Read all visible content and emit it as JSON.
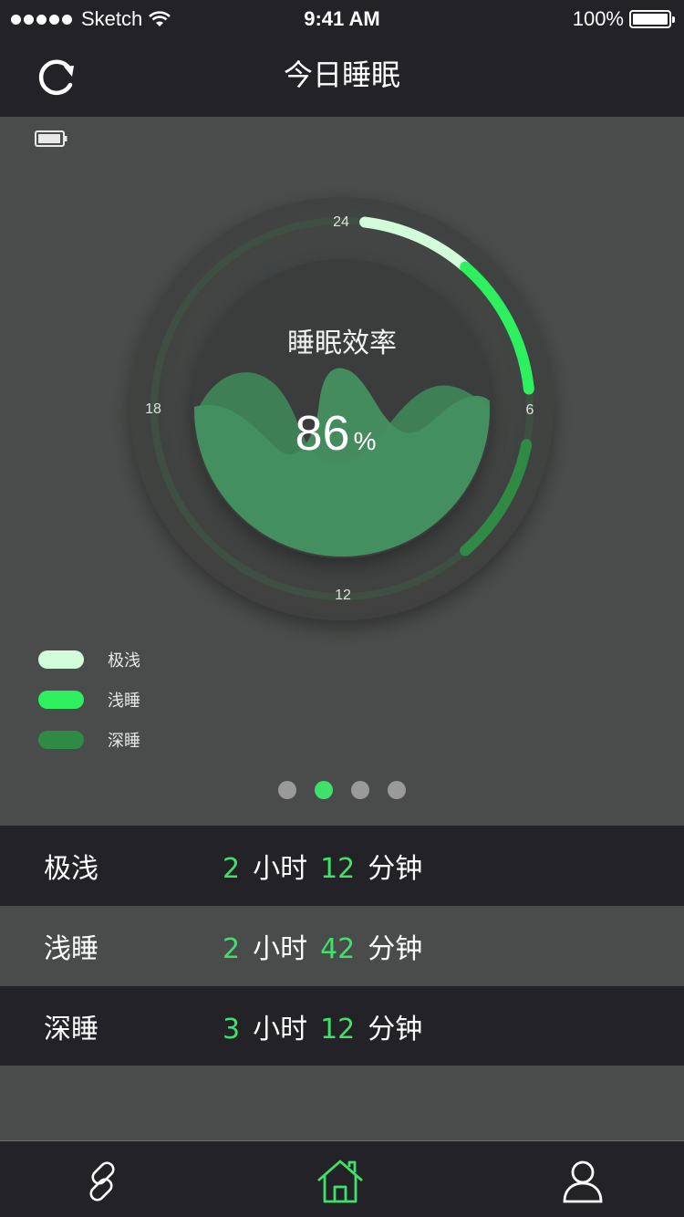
{
  "status_bar": {
    "carrier": "Sketch",
    "time": "9:41 AM",
    "battery": "100%"
  },
  "nav": {
    "title": "今日睡眠",
    "refresh_icon": "refresh-icon"
  },
  "dial": {
    "title": "睡眠效率",
    "value": "86",
    "unit": "%",
    "hour_labels": {
      "top": "24",
      "right": "6",
      "bottom": "12",
      "left": "18"
    }
  },
  "legend": [
    {
      "label": "极浅",
      "color": "#d2fbd9"
    },
    {
      "label": "浅睡",
      "color": "#2ef05f"
    },
    {
      "label": "深睡",
      "color": "#2f8a45"
    }
  ],
  "pager": {
    "count": 4,
    "active_index": 1
  },
  "stats": [
    {
      "label": "极浅",
      "hours": "2",
      "hours_unit": "小时",
      "minutes": "12",
      "minutes_unit": "分钟"
    },
    {
      "label": "浅睡",
      "hours": "2",
      "hours_unit": "小时",
      "minutes": "42",
      "minutes_unit": "分钟"
    },
    {
      "label": "深睡",
      "hours": "3",
      "hours_unit": "小时",
      "minutes": "12",
      "minutes_unit": "分钟"
    }
  ],
  "tabs": [
    {
      "icon": "link-icon"
    },
    {
      "icon": "home-icon",
      "active": true
    },
    {
      "icon": "user-icon"
    }
  ],
  "colors": {
    "accent": "#3ee26a",
    "bar_dark": "#232327",
    "panel": "#4a4c4b"
  }
}
